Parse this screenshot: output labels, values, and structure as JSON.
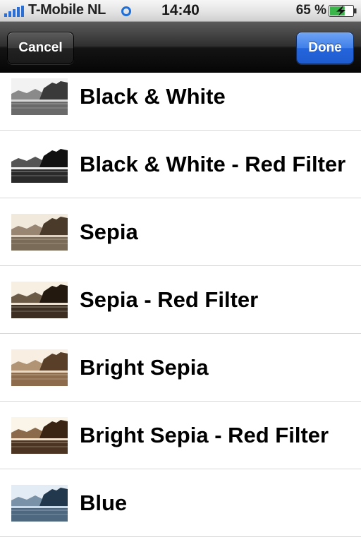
{
  "status_bar": {
    "carrier": "T-Mobile NL",
    "time": "14:40",
    "battery_percent": "65 %",
    "battery_level": 0.65,
    "signal_icon": "signal-bars-icon",
    "activity_icon": "wifi-activity-icon",
    "battery_icon": "battery-charging-icon"
  },
  "nav_bar": {
    "cancel_label": "Cancel",
    "done_label": "Done"
  },
  "filters": [
    {
      "label": "Black & White",
      "tint": "bw"
    },
    {
      "label": "Black & White - Red Filter",
      "tint": "bw-red"
    },
    {
      "label": "Sepia",
      "tint": "sepia"
    },
    {
      "label": "Sepia - Red Filter",
      "tint": "sepia-red"
    },
    {
      "label": "Bright Sepia",
      "tint": "bright-sepia"
    },
    {
      "label": "Bright Sepia - Red Filter",
      "tint": "bright-sepia-red"
    },
    {
      "label": "Blue",
      "tint": "blue"
    }
  ],
  "colors": {
    "done_button": "#2f6fe3",
    "cancel_button": "#2a2a2a",
    "nav_bar": "#1a1a1a",
    "separator": "#d7d7d7"
  }
}
